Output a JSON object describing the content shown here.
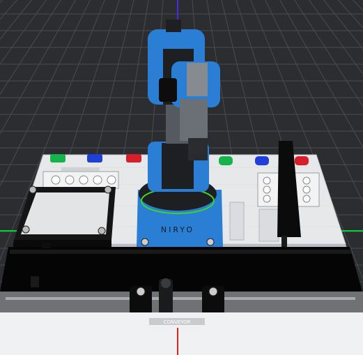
{
  "scene": {
    "robot_brand": "NIRYO",
    "conveyor_label": "CONVEYOR",
    "colors": {
      "background": "#2b2d30",
      "grid": "#4a4c50",
      "x_axis": "#e0201a",
      "y_axis": "#00d43a",
      "z_axis": "#4a2bdc",
      "robot_blue": "#2a7fd4",
      "robot_dark": "#1e1f22",
      "base_ring": "#3bd42a",
      "board": "#e7e8ea",
      "board_shadow": "#b9bcc2",
      "conveyor_belt": "#050505",
      "swatch_green": "#16b34a",
      "swatch_blue": "#1f3fd8",
      "swatch_red": "#d81e2a"
    },
    "icons": {
      "axes": "xyz-axes-icon",
      "pallet": "pallet-grid-icon"
    }
  }
}
